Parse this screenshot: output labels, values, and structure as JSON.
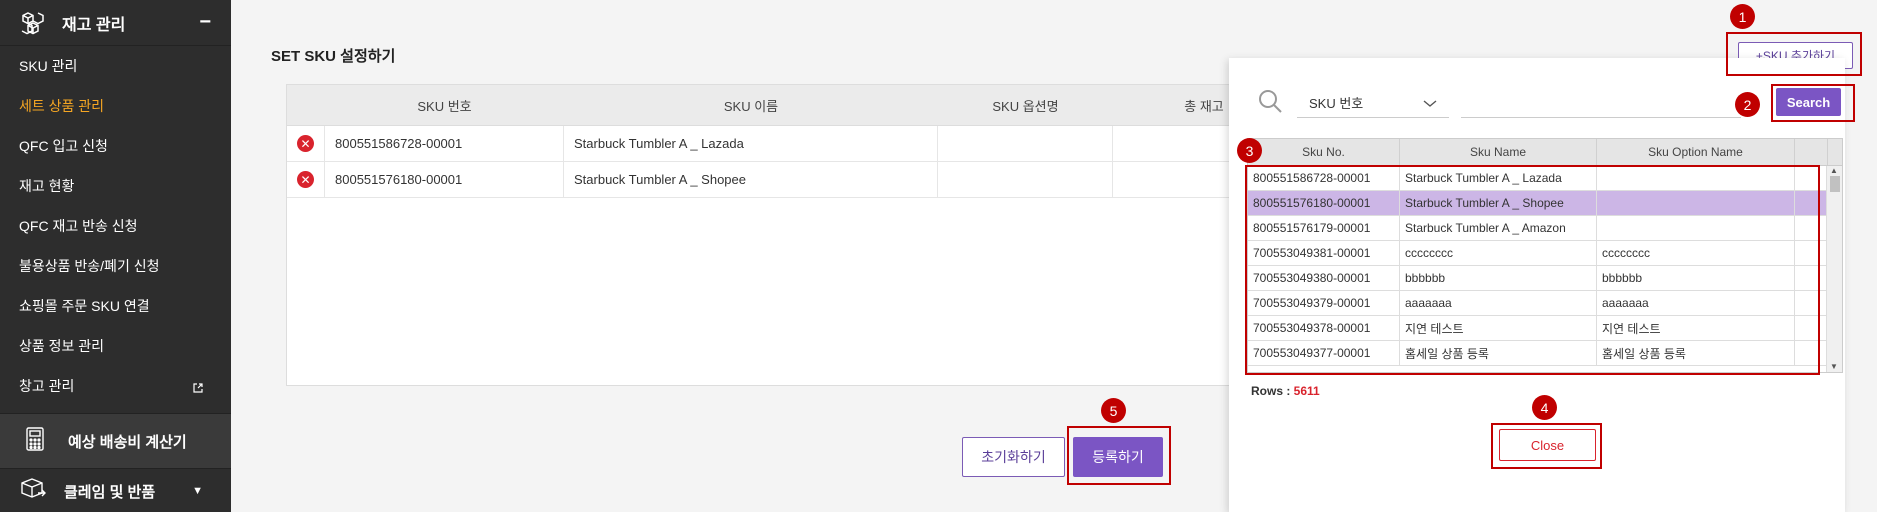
{
  "sidebar": {
    "header": {
      "title": "재고 관리",
      "toggle": "−"
    },
    "items": [
      {
        "label": "SKU 관리",
        "active": false
      },
      {
        "label": "세트 상품 관리",
        "active": true
      },
      {
        "label": "QFC 입고 신청",
        "active": false
      },
      {
        "label": "재고 현황",
        "active": false
      },
      {
        "label": "QFC 재고 반송 신청",
        "active": false
      },
      {
        "label": "불용상품 반송/폐기 신청",
        "active": false
      },
      {
        "label": "쇼핑몰 주문 SKU 연결",
        "active": false
      },
      {
        "label": "상품 정보 관리",
        "active": false
      },
      {
        "label": "창고 관리",
        "active": false,
        "external": true
      }
    ],
    "calculator": {
      "title": "예상 배송비 계산기"
    },
    "claim": {
      "title": "클레임 및 반품"
    }
  },
  "main": {
    "title": "SET SKU 설정하기",
    "table": {
      "headers": {
        "no": "SKU 번호",
        "name": "SKU 이름",
        "option": "SKU 옵션명",
        "stock": "총 재고"
      },
      "rows": [
        {
          "no": "800551586728-00001",
          "name": "Starbuck Tumbler A _ Lazada",
          "option": ""
        },
        {
          "no": "800551576180-00001",
          "name": "Starbuck Tumbler A _ Shopee",
          "option": ""
        }
      ]
    },
    "reset_label": "초기화하기",
    "submit_label": "등록하기",
    "add_sku_label": "+SKU 추가하기"
  },
  "popup": {
    "search_type": "SKU 번호",
    "search_value": "",
    "search_label": "Search",
    "headers": {
      "no": "Sku No.",
      "name": "Sku Name",
      "option": "Sku Option Name"
    },
    "rows": [
      {
        "no": "800551586728-00001",
        "name": "Starbuck Tumbler A _ Lazada",
        "option": ""
      },
      {
        "no": "800551576180-00001",
        "name": "Starbuck Tumbler A _ Shopee",
        "option": "",
        "selected": true
      },
      {
        "no": "800551576179-00001",
        "name": "Starbuck Tumbler A _ Amazon",
        "option": ""
      },
      {
        "no": "700553049381-00001",
        "name": "cccccccc",
        "option": "cccccccc"
      },
      {
        "no": "700553049380-00001",
        "name": "bbbbbb",
        "option": "bbbbbb"
      },
      {
        "no": "700553049379-00001",
        "name": "aaaaaaa",
        "option": "aaaaaaa"
      },
      {
        "no": "700553049378-00001",
        "name": "지연 테스트",
        "option": "지연 테스트"
      },
      {
        "no": "700553049377-00001",
        "name": "홈세일 상품 등록",
        "option": "홈세일 상품 등록"
      }
    ],
    "rows_label": "Rows : ",
    "rows_count": "5611",
    "close_label": "Close"
  },
  "annotations": [
    "1",
    "2",
    "3",
    "4",
    "5"
  ],
  "colors": {
    "accent": "#7b55c4",
    "annotation": "#c00000",
    "active_menu": "#f5a623",
    "sidebar_bg": "#2d2d2d",
    "selected_row": "#ccb6e6"
  }
}
